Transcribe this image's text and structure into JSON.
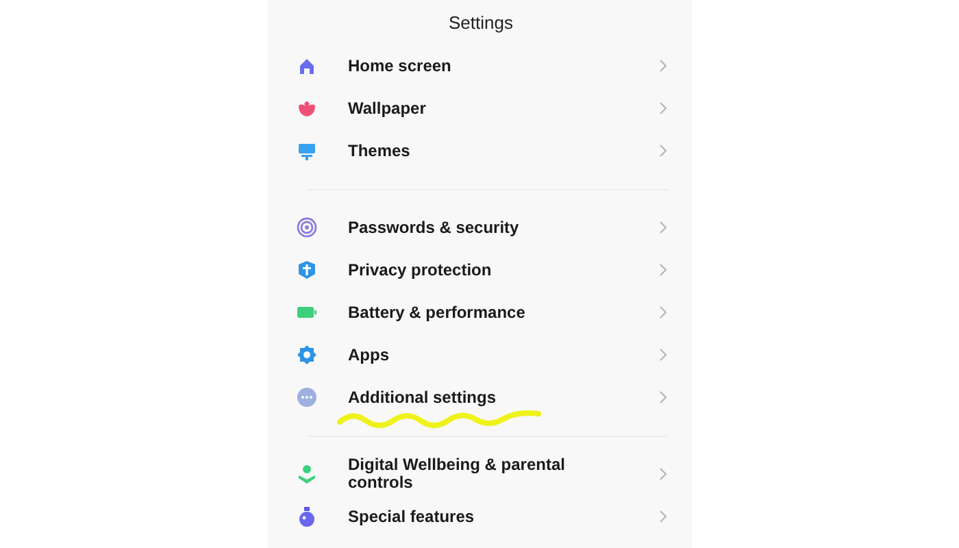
{
  "title": "Settings",
  "groups": [
    {
      "items": [
        {
          "label": "Home screen",
          "marked": false
        },
        {
          "label": "Wallpaper",
          "marked": false
        },
        {
          "label": "Themes",
          "marked": false
        }
      ]
    },
    {
      "items": [
        {
          "label": "Passwords & security",
          "marked": false
        },
        {
          "label": "Privacy protection",
          "marked": false
        },
        {
          "label": "Battery & performance",
          "marked": false
        },
        {
          "label": "Apps",
          "marked": false
        },
        {
          "label": "Additional settings",
          "marked": true
        }
      ]
    },
    {
      "items": [
        {
          "label": "Digital Wellbeing & parental controls",
          "marked": false
        },
        {
          "label": "Special features",
          "marked": false
        }
      ]
    }
  ]
}
